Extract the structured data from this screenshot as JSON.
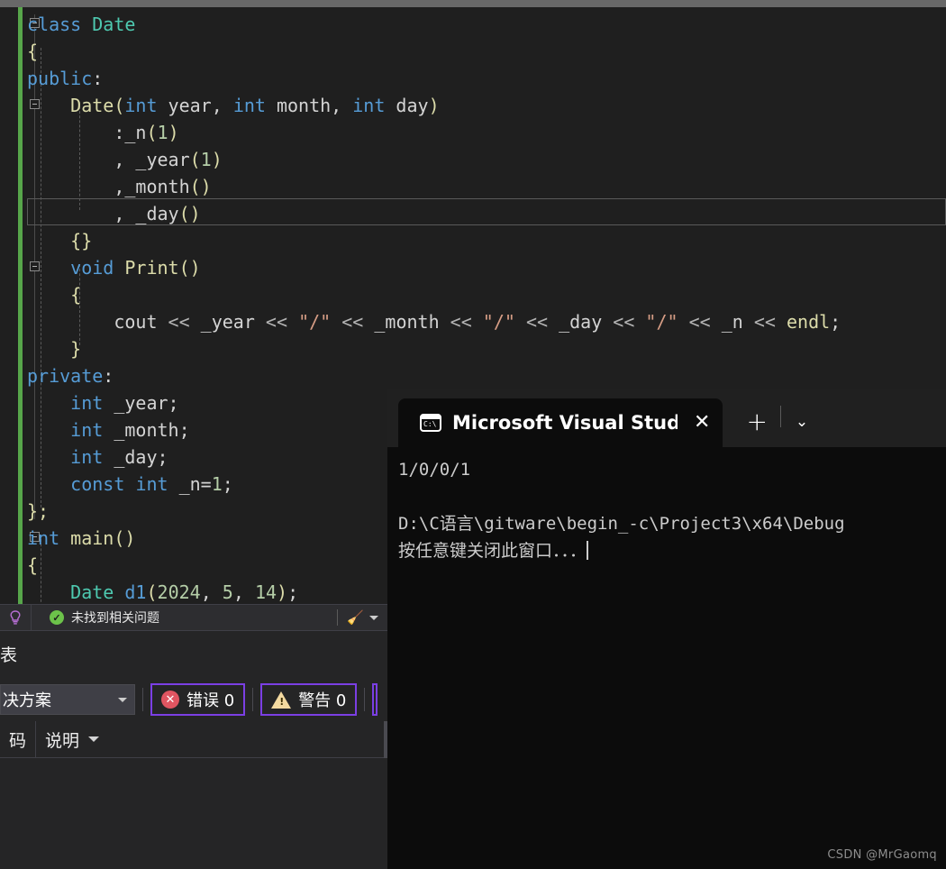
{
  "editor": {
    "language": "cpp",
    "current_line_index": 7,
    "lines": [
      {
        "indent": 0,
        "fold": true,
        "tokens": [
          {
            "t": "class",
            "c": "kw"
          },
          {
            "t": " ",
            "c": "plain"
          },
          {
            "t": "Date",
            "c": "type"
          }
        ]
      },
      {
        "indent": 0,
        "fold": false,
        "tokens": [
          {
            "t": "{",
            "c": "brace"
          }
        ]
      },
      {
        "indent": 0,
        "fold": false,
        "tokens": [
          {
            "t": "public",
            "c": "kw"
          },
          {
            "t": ":",
            "c": "plain"
          }
        ]
      },
      {
        "indent": 1,
        "fold": true,
        "tokens": [
          {
            "t": "Date",
            "c": "fn"
          },
          {
            "t": "(",
            "c": "punc"
          },
          {
            "t": "int",
            "c": "kw"
          },
          {
            "t": " year, ",
            "c": "plain"
          },
          {
            "t": "int",
            "c": "kw"
          },
          {
            "t": " month, ",
            "c": "plain"
          },
          {
            "t": "int",
            "c": "kw"
          },
          {
            "t": " day",
            "c": "plain"
          },
          {
            "t": ")",
            "c": "punc"
          }
        ]
      },
      {
        "indent": 2,
        "fold": false,
        "tokens": [
          {
            "t": ":",
            "c": "plain"
          },
          {
            "t": "_n",
            "c": "plain"
          },
          {
            "t": "(",
            "c": "punc"
          },
          {
            "t": "1",
            "c": "num"
          },
          {
            "t": ")",
            "c": "punc"
          }
        ]
      },
      {
        "indent": 2,
        "fold": false,
        "tokens": [
          {
            "t": ", _year",
            "c": "plain"
          },
          {
            "t": "(",
            "c": "punc"
          },
          {
            "t": "1",
            "c": "num"
          },
          {
            "t": ")",
            "c": "punc"
          }
        ]
      },
      {
        "indent": 2,
        "fold": false,
        "tokens": [
          {
            "t": ",_month",
            "c": "plain"
          },
          {
            "t": "()",
            "c": "punc"
          }
        ]
      },
      {
        "indent": 2,
        "fold": false,
        "tokens": [
          {
            "t": ", _day",
            "c": "plain"
          },
          {
            "t": "()",
            "c": "punc"
          }
        ]
      },
      {
        "indent": 1,
        "fold": false,
        "tokens": [
          {
            "t": "{}",
            "c": "brace"
          }
        ]
      },
      {
        "indent": 1,
        "fold": true,
        "tokens": [
          {
            "t": "void",
            "c": "kw"
          },
          {
            "t": " ",
            "c": "plain"
          },
          {
            "t": "Print",
            "c": "fn"
          },
          {
            "t": "()",
            "c": "punc"
          }
        ]
      },
      {
        "indent": 1,
        "fold": false,
        "tokens": [
          {
            "t": "{",
            "c": "brace"
          }
        ]
      },
      {
        "indent": 2,
        "fold": false,
        "tokens": [
          {
            "t": "cout",
            "c": "plain"
          },
          {
            "t": " << ",
            "c": "op"
          },
          {
            "t": "_year",
            "c": "plain"
          },
          {
            "t": " << ",
            "c": "op"
          },
          {
            "t": "\"/\"",
            "c": "str"
          },
          {
            "t": " << ",
            "c": "op"
          },
          {
            "t": "_month",
            "c": "plain"
          },
          {
            "t": " << ",
            "c": "op"
          },
          {
            "t": "\"/\"",
            "c": "str"
          },
          {
            "t": " << ",
            "c": "op"
          },
          {
            "t": "_day",
            "c": "plain"
          },
          {
            "t": " << ",
            "c": "op"
          },
          {
            "t": "\"/\"",
            "c": "str"
          },
          {
            "t": " << ",
            "c": "op"
          },
          {
            "t": "_n",
            "c": "plain"
          },
          {
            "t": " << ",
            "c": "op"
          },
          {
            "t": "endl",
            "c": "fn"
          },
          {
            "t": ";",
            "c": "plain"
          }
        ]
      },
      {
        "indent": 1,
        "fold": false,
        "tokens": [
          {
            "t": "}",
            "c": "brace"
          }
        ]
      },
      {
        "indent": 0,
        "fold": false,
        "tokens": [
          {
            "t": "private",
            "c": "kw"
          },
          {
            "t": ":",
            "c": "plain"
          }
        ]
      },
      {
        "indent": 1,
        "fold": false,
        "tokens": [
          {
            "t": "int",
            "c": "kw"
          },
          {
            "t": " _year;",
            "c": "plain"
          }
        ]
      },
      {
        "indent": 1,
        "fold": false,
        "tokens": [
          {
            "t": "int",
            "c": "kw"
          },
          {
            "t": " _month;",
            "c": "plain"
          }
        ]
      },
      {
        "indent": 1,
        "fold": false,
        "tokens": [
          {
            "t": "int",
            "c": "kw"
          },
          {
            "t": " _day;",
            "c": "plain"
          }
        ]
      },
      {
        "indent": 1,
        "fold": false,
        "tokens": [
          {
            "t": "const",
            "c": "kw"
          },
          {
            "t": " ",
            "c": "plain"
          },
          {
            "t": "int",
            "c": "kw"
          },
          {
            "t": " _n=",
            "c": "plain"
          },
          {
            "t": "1",
            "c": "num"
          },
          {
            "t": ";",
            "c": "plain"
          }
        ]
      },
      {
        "indent": 0,
        "fold": false,
        "tokens": [
          {
            "t": "};",
            "c": "brace"
          }
        ]
      },
      {
        "indent": 0,
        "fold": true,
        "tokens": [
          {
            "t": "int",
            "c": "kw"
          },
          {
            "t": " ",
            "c": "plain"
          },
          {
            "t": "main",
            "c": "fn"
          },
          {
            "t": "()",
            "c": "punc"
          }
        ]
      },
      {
        "indent": 0,
        "fold": false,
        "tokens": [
          {
            "t": "{",
            "c": "brace"
          }
        ]
      },
      {
        "indent": 1,
        "fold": false,
        "tokens": [
          {
            "t": "Date",
            "c": "type"
          },
          {
            "t": " ",
            "c": "plain"
          },
          {
            "t": "d1",
            "c": "kw"
          },
          {
            "t": "(",
            "c": "punc"
          },
          {
            "t": "2024",
            "c": "num"
          },
          {
            "t": ", ",
            "c": "plain"
          },
          {
            "t": "5",
            "c": "num"
          },
          {
            "t": ", ",
            "c": "plain"
          },
          {
            "t": "14",
            "c": "num"
          },
          {
            "t": ")",
            "c": "punc"
          },
          {
            "t": ";",
            "c": "plain"
          }
        ]
      }
    ]
  },
  "infobar": {
    "bulb_icon": "lightbulb-icon",
    "status_icon": "check-circle-icon",
    "status_text": "未找到相关问题",
    "broom_icon": "broom-icon",
    "dropdown_icon": "chevron-down-icon"
  },
  "error_list": {
    "title": "表",
    "scope_value": "决方案",
    "scope_caret_icon": "chevron-down-icon",
    "errors": {
      "icon": "error-circle-icon",
      "label": "错误 0"
    },
    "warnings": {
      "icon": "warning-triangle-icon",
      "label": "警告 0"
    },
    "columns": [
      {
        "label": "码"
      },
      {
        "label": "说明",
        "caret_icon": "chevron-down-icon"
      }
    ],
    "accent_border": "#7b3fe4"
  },
  "console": {
    "tab": {
      "icon": "terminal-cmd-icon",
      "icon_text": "C:\\",
      "title": "Microsoft Visual Stud",
      "close_icon": "close-icon"
    },
    "new_tab_icon": "plus-icon",
    "dropdown_icon": "chevron-down-icon",
    "output_lines": [
      "1/0/0/1",
      "",
      "D:\\C语言\\gitware\\begin_-c\\Project3\\x64\\Debug",
      "按任意键关闭此窗口．．．"
    ]
  },
  "watermark": "CSDN @MrGaomq",
  "colors": {
    "editor_bg": "#1f1f1f",
    "console_bg": "#0c0c0c",
    "change_bar": "#57a64a",
    "keyword": "#569cd6",
    "type": "#4ec9b0",
    "function": "#dcdcaa",
    "number": "#b5cea8",
    "string": "#d69d85",
    "accent": "#7b3fe4"
  }
}
